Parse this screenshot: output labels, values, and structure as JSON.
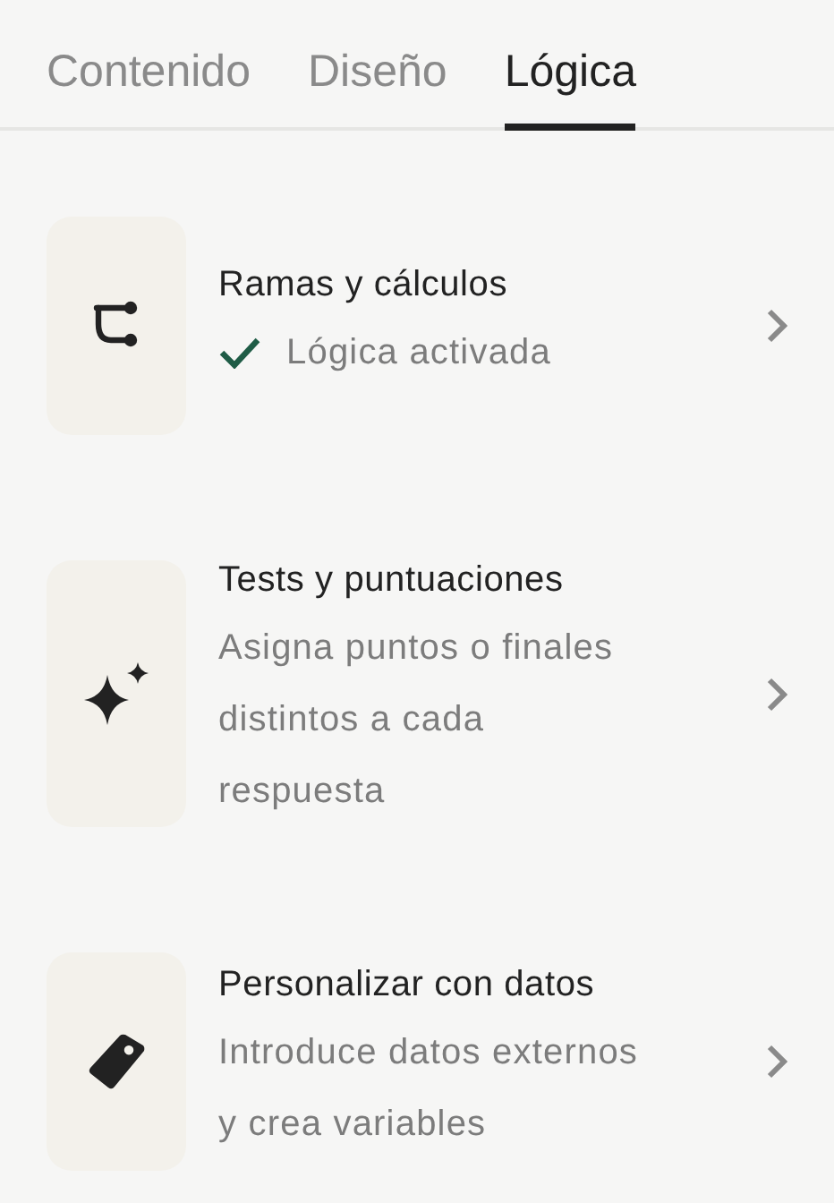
{
  "tabs": [
    {
      "label": "Contenido",
      "selected": false
    },
    {
      "label": "Diseño",
      "selected": false
    },
    {
      "label": "Lógica",
      "selected": true
    }
  ],
  "items": [
    {
      "kind": "branch",
      "title": "Ramas y cálculos",
      "subtitle": "Lógica activada",
      "active": true
    },
    {
      "kind": "sparkle",
      "title": "Tests y puntuaciones",
      "subtitle": "Asigna puntos o finales distintos a cada respuesta",
      "active": false
    },
    {
      "kind": "tag",
      "title": "Personalizar con datos",
      "subtitle": "Introduce datos externos y crea variables",
      "active": false
    }
  ]
}
